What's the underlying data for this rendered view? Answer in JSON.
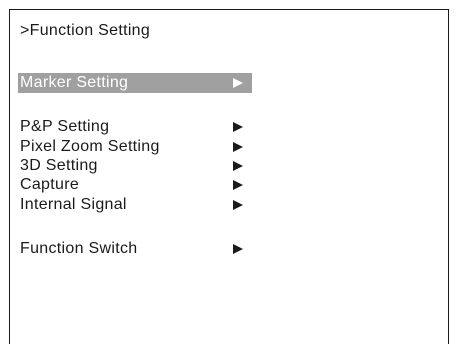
{
  "menu": {
    "title": ">Function Setting",
    "items": [
      {
        "label": "Marker Setting",
        "arrow": "right-triangle",
        "selected": true
      },
      {
        "label": "P&P Setting",
        "arrow": "right-triangle",
        "selected": false
      },
      {
        "label": "Pixel Zoom Setting",
        "arrow": "right-triangle",
        "selected": false
      },
      {
        "label": "3D Setting",
        "arrow": "right-triangle",
        "selected": false
      },
      {
        "label": "Capture",
        "arrow": "right-triangle",
        "selected": false
      },
      {
        "label": "Internal Signal",
        "arrow": "right-triangle",
        "selected": false
      },
      {
        "label": "Function Switch",
        "arrow": "right-triangle",
        "selected": false
      }
    ]
  },
  "colors": {
    "text": "#1a1a1a",
    "background": "#ffffff",
    "highlight": "#a0a0a0",
    "highlight_text": "#ffffff"
  }
}
